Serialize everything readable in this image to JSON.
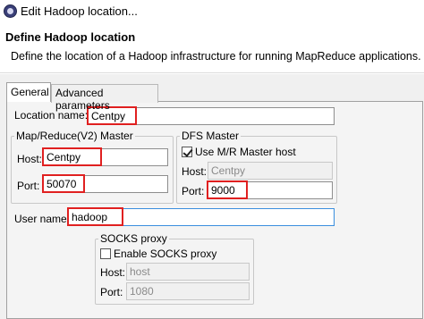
{
  "window": {
    "title": "Edit Hadoop location..."
  },
  "header": {
    "title": "Define Hadoop location",
    "description": "Define the location of a Hadoop infrastructure for running MapReduce applications."
  },
  "tabs": [
    {
      "label": "General",
      "active": true
    },
    {
      "label": "Advanced parameters",
      "active": false
    }
  ],
  "general": {
    "location_name": {
      "label": "Location name:",
      "value": "Centpy"
    },
    "mapreduce_master": {
      "title": "Map/Reduce(V2) Master",
      "host": {
        "label": "Host:",
        "value": "Centpy"
      },
      "port": {
        "label": "Port:",
        "value": "50070"
      }
    },
    "dfs_master": {
      "title": "DFS Master",
      "use_mr_host": {
        "label": "Use M/R Master host",
        "checked": true
      },
      "host": {
        "label": "Host:",
        "value": "Centpy"
      },
      "port": {
        "label": "Port:",
        "value": "9000"
      }
    },
    "user_name": {
      "label": "User name:",
      "value": "hadoop"
    },
    "socks_proxy": {
      "title": "SOCKS proxy",
      "enable": {
        "label": "Enable SOCKS proxy",
        "checked": false
      },
      "host": {
        "label": "Host:",
        "value": "host"
      },
      "port": {
        "label": "Port:",
        "value": "1080"
      }
    }
  },
  "colors": {
    "highlight": "#e02020",
    "focus_border": "#3a8ede",
    "background": "#f0f0f0"
  }
}
